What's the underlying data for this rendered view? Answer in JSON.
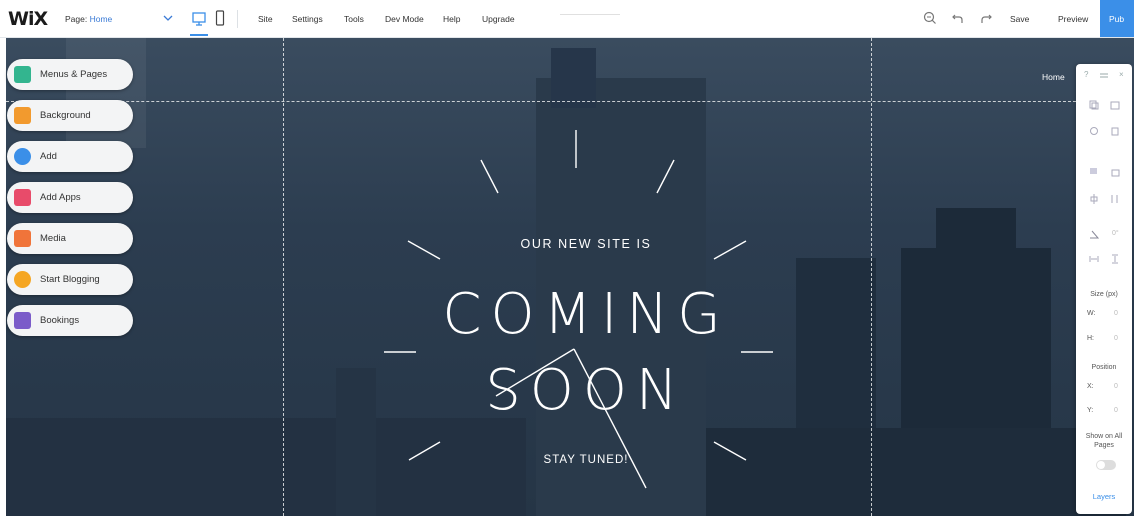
{
  "topbar": {
    "logo": "WiX",
    "page_prefix": "Page:",
    "page_value": "Home",
    "menu": [
      "Site",
      "Settings",
      "Tools",
      "Dev Mode",
      "Help",
      "Upgrade"
    ],
    "save": "Save",
    "preview": "Preview",
    "publish": "Pub"
  },
  "left_panel": {
    "items": [
      {
        "label": "Menus & Pages",
        "icon": "menus-pages-icon",
        "color": "#33b58f"
      },
      {
        "label": "Background",
        "icon": "background-icon",
        "color": "#f29a2e"
      },
      {
        "label": "Add",
        "icon": "add-icon",
        "color": "#3b8fe8"
      },
      {
        "label": "Add Apps",
        "icon": "add-apps-icon",
        "color": "#e84b6a"
      },
      {
        "label": "Media",
        "icon": "media-icon",
        "color": "#f0743a"
      },
      {
        "label": "Start Blogging",
        "icon": "blog-icon",
        "color": "#f5a623"
      },
      {
        "label": "Bookings",
        "icon": "bookings-icon",
        "color": "#7b5cc9"
      }
    ]
  },
  "canvas": {
    "home_label": "Home",
    "line1": "OUR NEW SITE IS",
    "line2": "COMING",
    "line3": "SOON",
    "line4": "STAY TUNED!"
  },
  "right_panel": {
    "size_label": "Size (px)",
    "w_label": "W:",
    "h_label": "H:",
    "w_value": "0",
    "h_value": "0",
    "position_label": "Position",
    "x_label": "X:",
    "y_label": "Y:",
    "x_value": "0",
    "y_value": "0",
    "show_all_line1": "Show on All",
    "show_all_line2": "Pages",
    "layers": "Layers"
  },
  "colors": {
    "accent": "#3b8fe8",
    "canvas_bg": "#2c3d50"
  }
}
